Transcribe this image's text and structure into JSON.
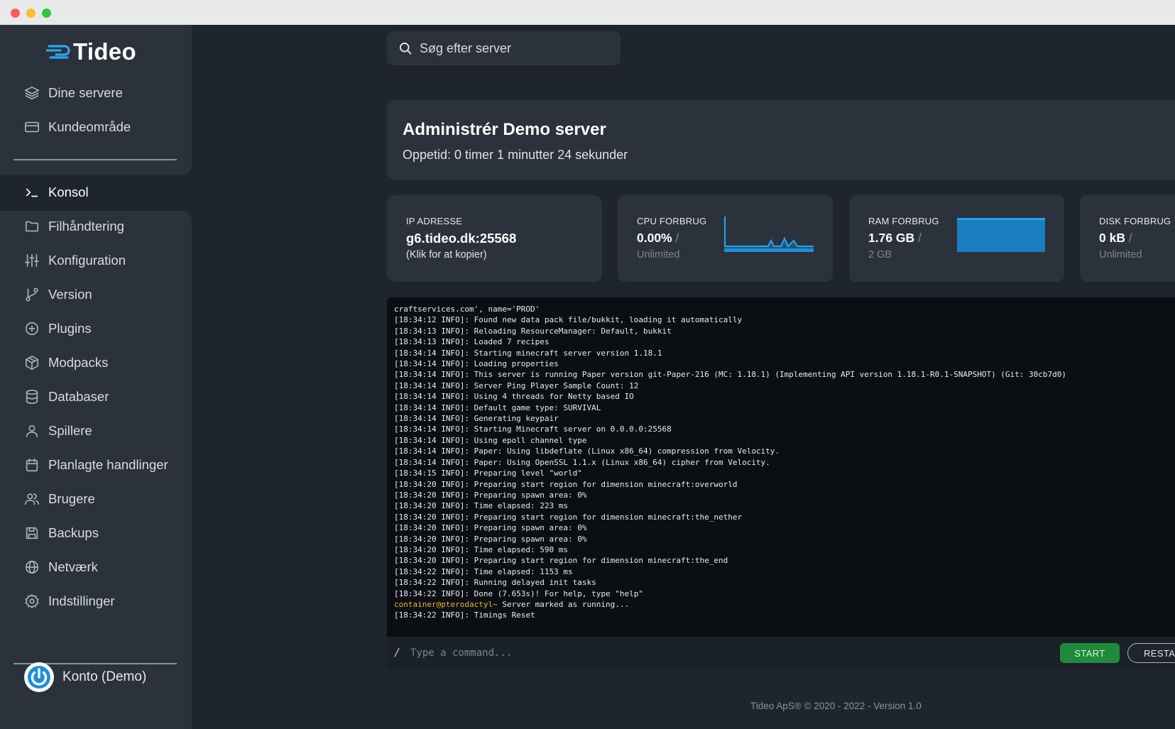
{
  "app": {
    "logo_text": "Tideo",
    "brand_color": "#2aa6ef"
  },
  "sidebar": {
    "top_items": [
      {
        "label": "Dine servere",
        "icon": "layers-icon"
      },
      {
        "label": "Kundeområde",
        "icon": "credit-card-icon"
      }
    ],
    "items": [
      {
        "label": "Konsol",
        "icon": "terminal-icon",
        "active": true
      },
      {
        "label": "Filhåndtering",
        "icon": "folder-icon"
      },
      {
        "label": "Konfiguration",
        "icon": "sliders-icon"
      },
      {
        "label": "Version",
        "icon": "git-branch-icon"
      },
      {
        "label": "Plugins",
        "icon": "plus-circle-icon"
      },
      {
        "label": "Modpacks",
        "icon": "package-icon"
      },
      {
        "label": "Databaser",
        "icon": "database-icon"
      },
      {
        "label": "Spillere",
        "icon": "user-icon"
      },
      {
        "label": "Planlagte handlinger",
        "icon": "calendar-icon"
      },
      {
        "label": "Brugere",
        "icon": "users-icon"
      },
      {
        "label": "Backups",
        "icon": "save-icon"
      },
      {
        "label": "Netværk",
        "icon": "globe-icon"
      },
      {
        "label": "Indstillinger",
        "icon": "settings-icon"
      }
    ],
    "account_label": "Konto (Demo)"
  },
  "search": {
    "placeholder": "Søg efter server"
  },
  "header": {
    "title": "Administrér Demo server",
    "uptime": "Oppetid:  0 timer 1 minutter 24 sekunder"
  },
  "stats": {
    "ip": {
      "label": "IP ADRESSE",
      "value": "g6.tideo.dk:25568",
      "sub": "(Klik for at kopier)"
    },
    "cpu": {
      "label": "CPU FORBRUG",
      "value": "0.00%",
      "sub": "Unlimited",
      "usage_fraction": 0.0
    },
    "ram": {
      "label": "RAM FORBRUG",
      "value": "1.76 GB",
      "sub": "2 GB",
      "usage_fraction": 0.88
    },
    "disk": {
      "label": "DISK FORBRUG",
      "value": "0 kB",
      "sub": "Unlimited"
    }
  },
  "console": {
    "lines": [
      "craftservices.com', name='PROD'",
      "[18:34:12 INFO]: Found new data pack file/bukkit, loading it automatically",
      "[18:34:13 INFO]: Reloading ResourceManager: Default, bukkit",
      "[18:34:13 INFO]: Loaded 7 recipes",
      "[18:34:14 INFO]: Starting minecraft server version 1.18.1",
      "[18:34:14 INFO]: Loading properties",
      "[18:34:14 INFO]: This server is running Paper version git-Paper-216 (MC: 1.18.1) (Implementing API version 1.18.1-R0.1-SNAPSHOT) (Git: 30cb7d0)",
      "[18:34:14 INFO]: Server Ping Player Sample Count: 12",
      "[18:34:14 INFO]: Using 4 threads for Netty based IO",
      "[18:34:14 INFO]: Default game type: SURVIVAL",
      "[18:34:14 INFO]: Generating keypair",
      "[18:34:14 INFO]: Starting Minecraft server on 0.0.0.0:25568",
      "[18:34:14 INFO]: Using epoll channel type",
      "[18:34:14 INFO]: Paper: Using libdeflate (Linux x86_64) compression from Velocity.",
      "[18:34:14 INFO]: Paper: Using OpenSSL 1.1.x (Linux x86_64) cipher from Velocity.",
      "[18:34:15 INFO]: Preparing level \"world\"",
      "[18:34:20 INFO]: Preparing start region for dimension minecraft:overworld",
      "[18:34:20 INFO]: Preparing spawn area: 0%",
      "[18:34:20 INFO]: Time elapsed: 223 ms",
      "[18:34:20 INFO]: Preparing start region for dimension minecraft:the_nether",
      "[18:34:20 INFO]: Preparing spawn area: 0%",
      "[18:34:20 INFO]: Preparing spawn area: 0%",
      "[18:34:20 INFO]: Time elapsed: 590 ms",
      "[18:34:20 INFO]: Preparing start region for dimension minecraft:the_end",
      "[18:34:22 INFO]: Time elapsed: 1153 ms",
      "[18:34:22 INFO]: Running delayed init tasks",
      "[18:34:22 INFO]: Done (7.653s)! For help, type \"help\""
    ],
    "prompt_user": "container@pterodactyl~",
    "prompt_text": " Server marked as running...",
    "last_line": "[18:34:22 INFO]: Timings Reset",
    "command_prefix": "/",
    "command_placeholder": "Type a command...",
    "start_label": "START",
    "restart_label": "RESTART",
    "start_color": "#1f8a3b",
    "prompt_color": "#f0b429"
  },
  "footer": {
    "text": "Tideo ApS® © 2020 - 2022 - Version 1.0"
  }
}
